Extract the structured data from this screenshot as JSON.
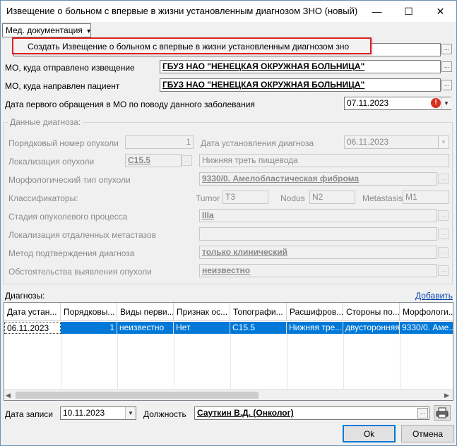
{
  "window": {
    "title": "Извещение о больном с впервые в жизни установленным диагнозом ЗНО (новый)",
    "minimize": "—",
    "maximize": "☐",
    "close": "✕"
  },
  "menu": {
    "button_label": "Мед. документация",
    "arrow": "▾",
    "popup_item": "Создать Извещение о больном с впервые в жизни установленным диагнозом зно"
  },
  "form": {
    "mo_sent_label": "МО, куда отправлено извещение",
    "mo_sent_value": "ГБУЗ НАО \"НЕНЕЦКАЯ ОКРУЖНАЯ БОЛЬНИЦА\"",
    "mo_patient_label": "МО, куда направлен пациент",
    "mo_patient_value": "ГБУЗ НАО \"НЕНЕЦКАЯ ОКРУЖНАЯ БОЛЬНИЦА\"",
    "first_visit_label": "Дата первого обращения в МО по поводу данного заболевания",
    "first_visit_value": "07.11.2023",
    "dots": "..."
  },
  "diagnosis_data": {
    "group_title": "Данные диагноза:",
    "tumor_number_label": "Порядковый номер опухоли",
    "tumor_number_value": "1",
    "diag_date_label": "Дата установления диагноза",
    "diag_date_value": "06.11.2023",
    "localization_label": "Локализация опухоли",
    "localization_code": "C15.5",
    "localization_text": "Нижняя треть пищевода",
    "morph_label": "Морфологический тип опухоли",
    "morph_value": "9330/0. Амелобластическая фиброма",
    "classifiers_label": "Классификаторы:",
    "tumor_label": "Tumor",
    "tumor_value": "T3",
    "nodus_label": "Nodus",
    "nodus_value": "N2",
    "metastasis_label": "Metastasis",
    "metastasis_value": "M1",
    "stage_label": "Стадия опухолевого процесса",
    "stage_value": "IIIa",
    "distant_label": "Локализация отдаленных метастазов",
    "distant_value": "",
    "method_label": "Метод подтверждения диагноза",
    "method_value": "только клинический",
    "circ_label": "Обстоятельства выявления опухоли",
    "circ_value": "неизвестно"
  },
  "diagnoses": {
    "label": "Диагнозы:",
    "add_link": "Добавить",
    "columns": [
      "Дата устан...",
      "Порядковы...",
      "Виды перви...",
      "Признак ос...",
      "Топографи...",
      "Расшифров...",
      "Стороны по...",
      "Морфологи..."
    ],
    "rows": [
      [
        "06.11.2023",
        "1",
        "неизвестно",
        "Нет",
        "C15.5",
        "Нижняя тре...",
        "двусторонняя",
        "9330/0. Аме..."
      ]
    ]
  },
  "footer": {
    "record_date_label": "Дата записи",
    "record_date_value": "10.11.2023",
    "position_label": "Должность",
    "position_value": "Сауткин В.Д. (Онколог)",
    "ok": "Ok",
    "cancel": "Отмена"
  },
  "colors": {
    "selection": "#0078d7",
    "highlight_border": "#e02020",
    "link": "#0645ad"
  },
  "icons": {
    "warning": "warning-icon",
    "print": "printer-icon"
  }
}
